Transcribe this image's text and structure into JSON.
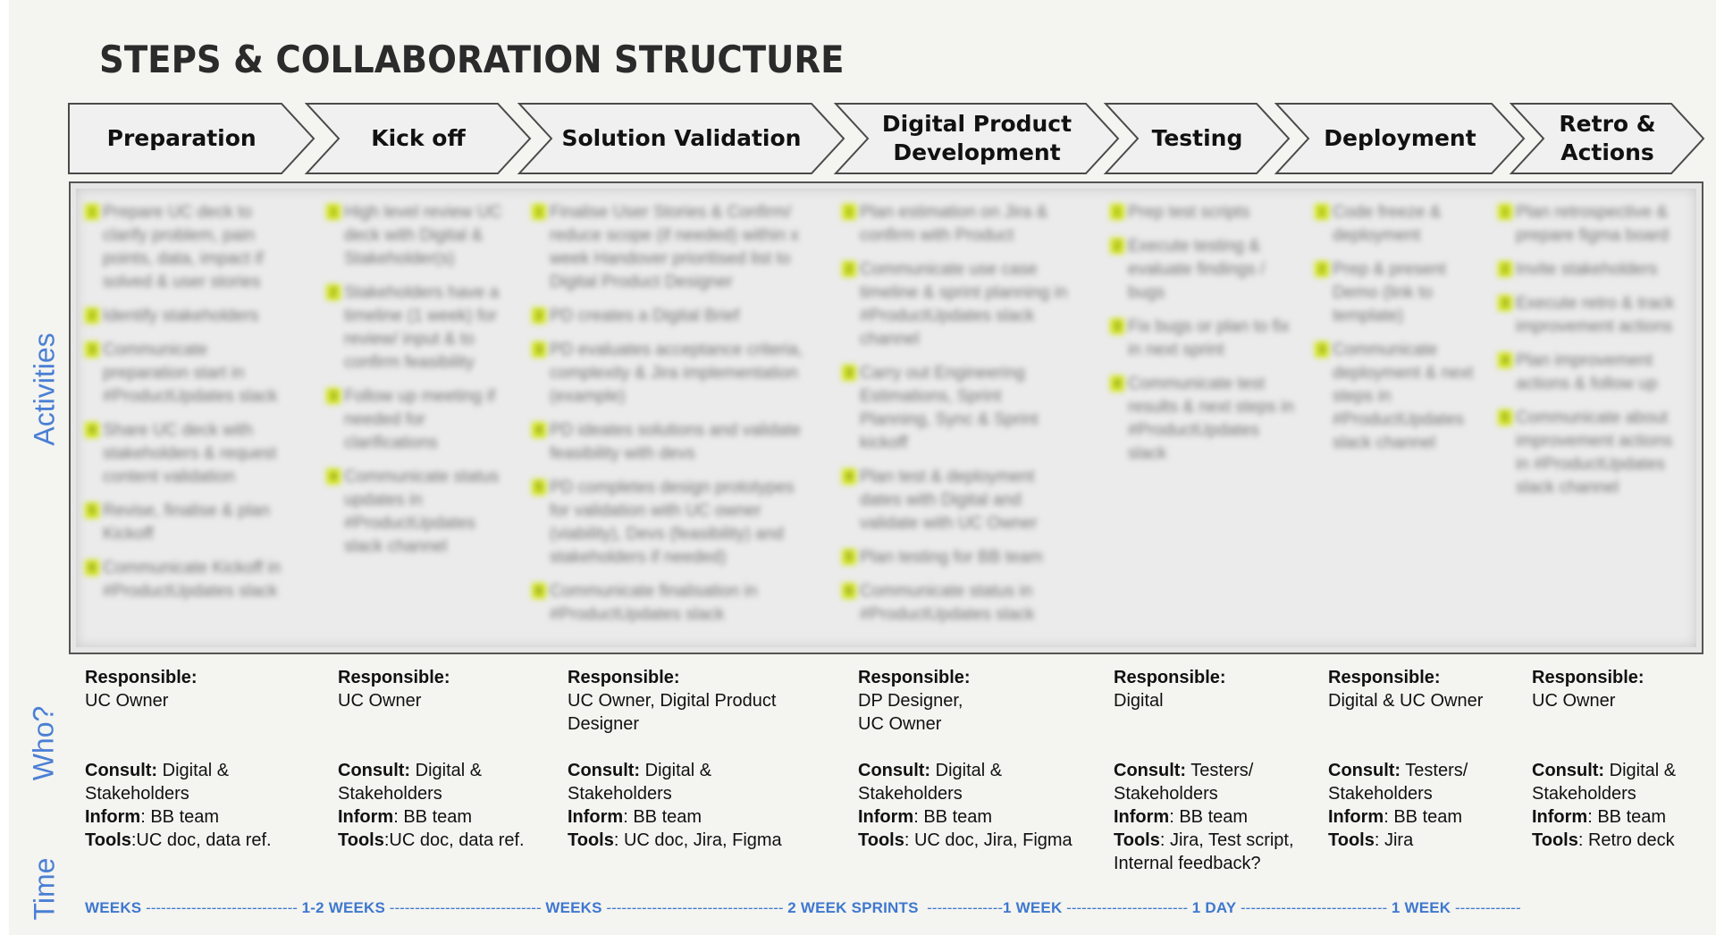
{
  "title": "STEPS & COLLABORATION STRUCTURE",
  "side_labels": {
    "activities": "Activities",
    "who": "Who?",
    "time": "Time"
  },
  "steps": [
    {
      "label": "Preparation",
      "activities": [
        {
          "n": "1",
          "text": "Prepare UC deck to clarify problem, pain points, data, impact if solved & user stories"
        },
        {
          "n": "2",
          "text": "Identify stakeholders"
        },
        {
          "n": "3",
          "text": "Communicate preparation start in #ProductUpdates slack"
        },
        {
          "n": "4",
          "text": "Share UC deck with stakeholders & request content validation"
        },
        {
          "n": "5",
          "text": "Revise, finalise & plan Kickoff"
        },
        {
          "n": "6",
          "text": "Communicate Kickoff in #ProductUpdates slack"
        }
      ],
      "responsible_label": "Responsible:",
      "responsible": "UC Owner",
      "consult_label": "Consult:",
      "consult": " Digital & Stakeholders",
      "inform_label": "Inform",
      "inform": ": BB team",
      "tools_label": "Tools",
      "tools": ":UC doc, data ref."
    },
    {
      "label": "Kick off",
      "activities": [
        {
          "n": "1",
          "text": "High level review UC deck with Digital & Stakeholder(s)"
        },
        {
          "n": "2",
          "text": "Stakeholders have a timeline (1 week) for review/ input & to confirm feasibility"
        },
        {
          "n": "3",
          "text": "Follow up meeting if needed for clarifications"
        },
        {
          "n": "4",
          "text": "Communicate status updates in #ProductUpdates slack channel"
        }
      ],
      "responsible_label": "Responsible:",
      "responsible": "UC Owner",
      "consult_label": "Consult:",
      "consult": " Digital & Stakeholders",
      "inform_label": "Inform",
      "inform": ": BB team",
      "tools_label": "Tools",
      "tools": ":UC doc, data ref."
    },
    {
      "label": "Solution Validation",
      "activities": [
        {
          "n": "1",
          "text": "Finalise User Stories & Confirm/ reduce scope (if needed) within x week Handover prioritised list to Digital Product Designer"
        },
        {
          "n": "2",
          "text": "PD creates a Digital Brief"
        },
        {
          "n": "3",
          "text": "PD evaluates acceptance criteria, complexity & Jira implementation (example)"
        },
        {
          "n": "4",
          "text": "PD ideates solutions and validate feasibility with devs"
        },
        {
          "n": "5",
          "text": "PD completes design prototypes for validation with UC owner (viability), Devs (feasibility) and stakeholders if needed)"
        },
        {
          "n": "6",
          "text": "Communicate finalisation in #ProductUpdates slack"
        }
      ],
      "responsible_label": "Responsible:",
      "responsible": "UC Owner, Digital Product Designer",
      "consult_label": "Consult:",
      "consult": " Digital & Stakeholders",
      "inform_label": "Inform",
      "inform": ": BB team",
      "tools_label": "Tools",
      "tools": ": UC doc, Jira, Figma"
    },
    {
      "label": "Digital Product Development",
      "activities": [
        {
          "n": "1",
          "text": "Plan estimation on Jira & confirm with Product"
        },
        {
          "n": "2",
          "text": "Communicate use case timeline & sprint planning in #ProductUpdates slack channel"
        },
        {
          "n": "3",
          "text": "Carry out Engineering Estimations, Sprint Planning, Sync & Sprint kickoff"
        },
        {
          "n": "4",
          "text": "Plan test & deployment dates with Digital and validate with UC Owner"
        },
        {
          "n": "5",
          "text": "Plan testing for BB team"
        },
        {
          "n": "6",
          "text": "Communicate status in #ProductUpdates slack"
        }
      ],
      "responsible_label": "Responsible:",
      "responsible": "DP Designer,\nUC Owner",
      "consult_label": "Consult:",
      "consult": " Digital & Stakeholders",
      "inform_label": "Inform",
      "inform": ": BB team",
      "tools_label": "Tools",
      "tools": ": UC doc, Jira, Figma"
    },
    {
      "label": "Testing",
      "activities": [
        {
          "n": "1",
          "text": "Prep test scripts"
        },
        {
          "n": "2",
          "text": "Execute testing & evaluate findings / bugs"
        },
        {
          "n": "3",
          "text": "Fix bugs or plan to fix in next sprint"
        },
        {
          "n": "4",
          "text": "Communicate test results & next steps in #ProductUpdates slack"
        }
      ],
      "responsible_label": "Responsible:",
      "responsible": "Digital",
      "consult_label": "Consult:",
      "consult": " Testers/ Stakeholders",
      "inform_label": "Inform",
      "inform": ": BB team",
      "tools_label": "Tools",
      "tools": ": Jira, Test script, Internal feedback?"
    },
    {
      "label": "Deployment",
      "activities": [
        {
          "n": "1",
          "text": "Code freeze & deployment"
        },
        {
          "n": "2",
          "text": "Prep & present Demo (link to template)"
        },
        {
          "n": "3",
          "text": "Communicate deployment & next steps in #ProductUpdates slack channel"
        }
      ],
      "responsible_label": "Responsible:",
      "responsible": "Digital & UC Owner",
      "consult_label": "Consult:",
      "consult": " Testers/ Stakeholders",
      "inform_label": "Inform",
      "inform": ": BB team",
      "tools_label": "Tools",
      "tools": ": Jira"
    },
    {
      "label": "Retro & Actions",
      "activities": [
        {
          "n": "1",
          "text": "Plan retrospective & prepare figma board"
        },
        {
          "n": "2",
          "text": "Invite stakeholders"
        },
        {
          "n": "3",
          "text": "Execute retro & track improvement actions"
        },
        {
          "n": "4",
          "text": "Plan improvement actions & follow up"
        },
        {
          "n": "5",
          "text": "Communicate about improvement actions in #ProductUpdates slack channel"
        }
      ],
      "responsible_label": "Responsible:",
      "responsible": "UC Owner",
      "consult_label": "Consult:",
      "consult": " Digital & Stakeholders",
      "inform_label": "Inform",
      "inform": ": BB team",
      "tools_label": "Tools",
      "tools": ": Retro deck"
    }
  ],
  "timeline": [
    {
      "label": "WEEKS",
      "dashes": " ------------------------------ "
    },
    {
      "label": "1-2 WEEKS",
      "dashes": " ------------------------------ "
    },
    {
      "label": "WEEKS",
      "dashes": " ----------------------------------- "
    },
    {
      "label": "2 WEEK SPRINTS",
      "dashes": "  ---------------"
    },
    {
      "label": "1 WEEK",
      "dashes": " ------------------------ "
    },
    {
      "label": "1 DAY",
      "dashes": " ----------------------------- "
    },
    {
      "label": "1 WEEK",
      "dashes": " -------------"
    }
  ],
  "colors": {
    "accent": "#3e78cf",
    "chevron_fill": "#f0f0f0",
    "marker": "#d4e81a"
  }
}
